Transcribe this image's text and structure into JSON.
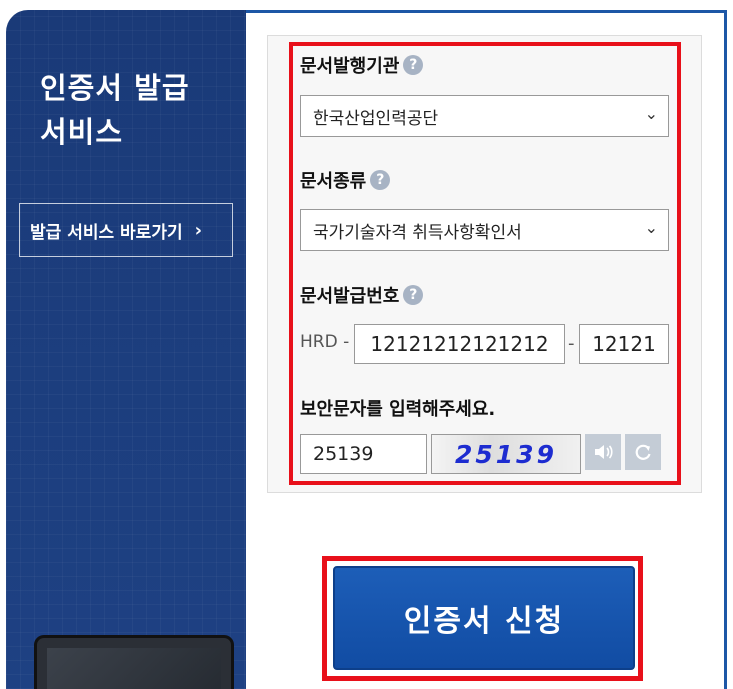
{
  "sidebar": {
    "title_line1": "인증서 발급",
    "title_line2": "서비스",
    "link_label": "발급 서비스 바로가기",
    "link_chevron": "›"
  },
  "form": {
    "issuer_label": "문서발행기관",
    "issuer_value": "한국산업인력공단",
    "doc_type_label": "문서종류",
    "doc_type_value": "국가기술자격 취득사항확인서",
    "doc_number_label": "문서발급번호",
    "doc_number_prefix": "HRD -",
    "doc_number_part1": "12121212121212",
    "doc_number_sep": "-",
    "doc_number_part2": "12121",
    "captcha_label": "보안문자를 입력해주세요.",
    "captcha_input": "25139",
    "captcha_image_text": "25139",
    "help_glyph": "?",
    "select_arrow": "⌄"
  },
  "icons": {
    "audio": "speaker-icon",
    "refresh": "refresh-icon",
    "help": "help-icon",
    "dropdown": "chevron-down-icon"
  },
  "submit_label": "인증서 신청",
  "colors": {
    "sidebar_bg": "#1d3f7c",
    "highlight_red": "#e8101a",
    "button_blue": "#1558b0",
    "captcha_text": "#1d2cd0"
  }
}
